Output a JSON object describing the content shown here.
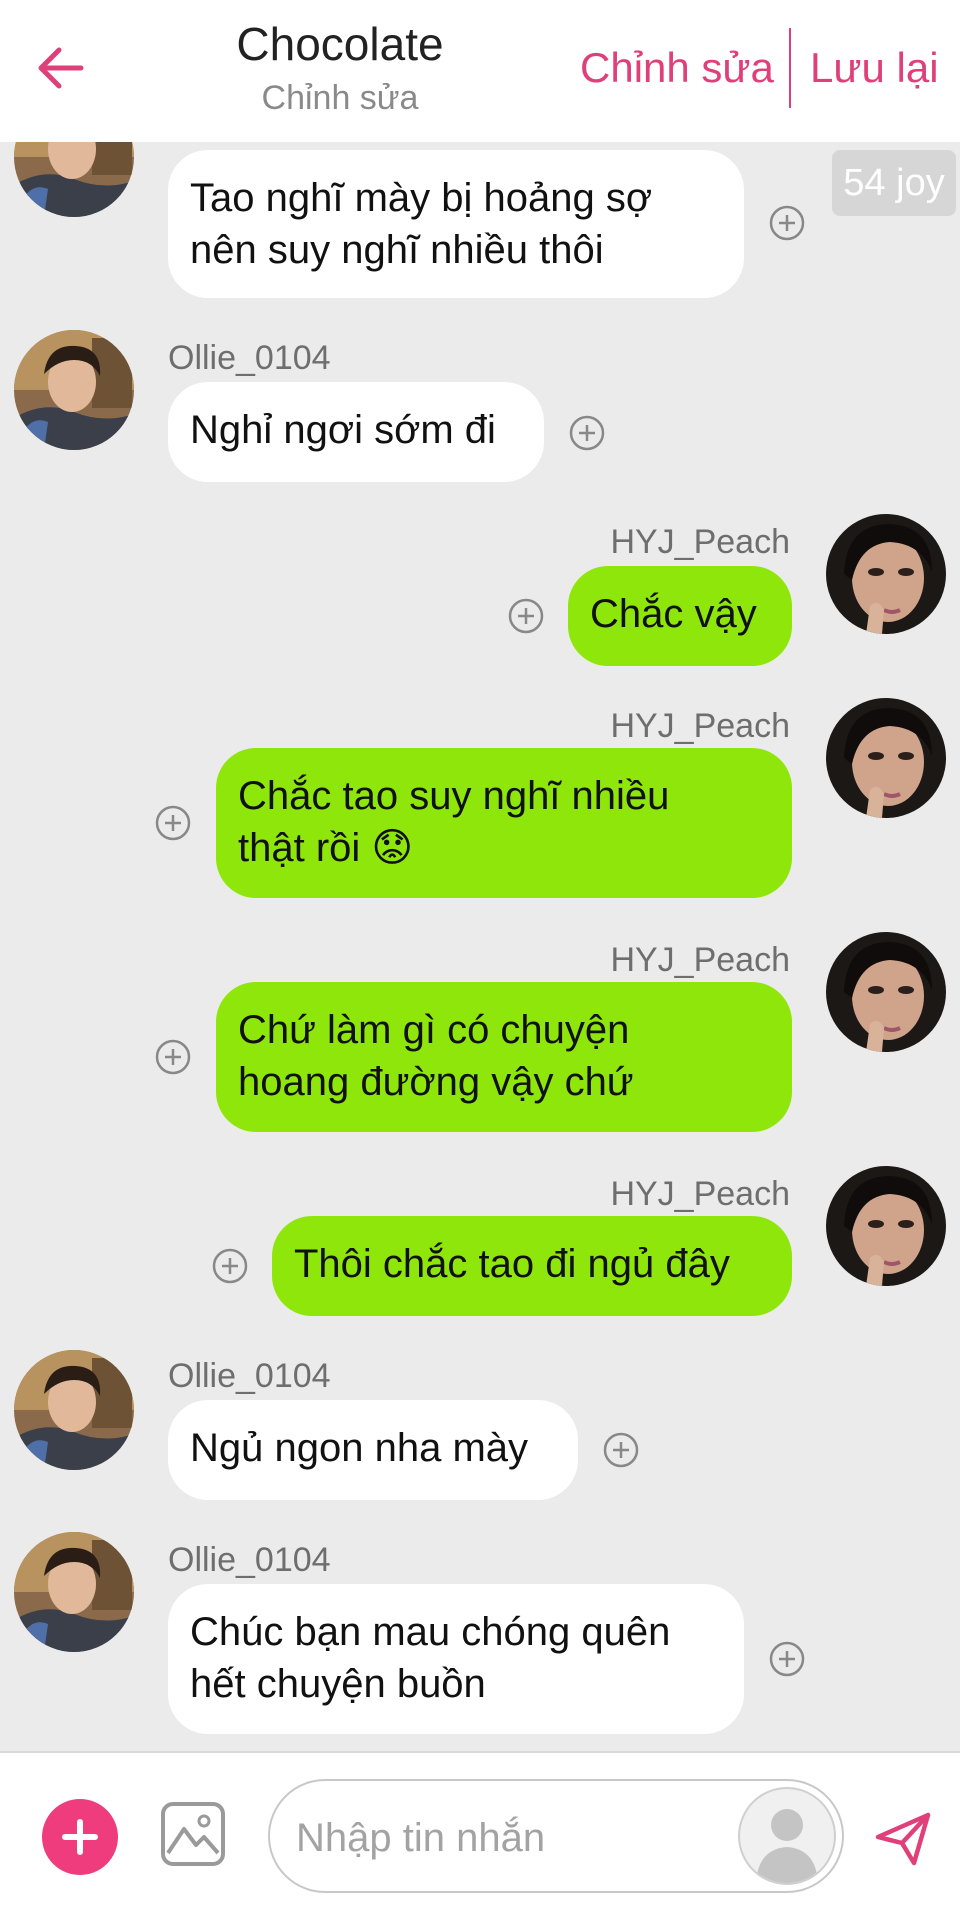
{
  "header": {
    "title": "Chocolate",
    "subtitle": "Chỉnh sửa",
    "edit_label": "Chỉnh sửa",
    "save_label": "Lưu lại",
    "accent_color": "#e0407a"
  },
  "joy_badge": "54 joy",
  "messages": [
    {
      "sender": "Ollie_0104",
      "direction": "incoming",
      "lines": [
        "Tao nghĩ mày bị hoảng sợ",
        "nên suy nghĩ nhiều thôi"
      ],
      "username_visible": false
    },
    {
      "sender": "Ollie_0104",
      "direction": "incoming",
      "lines": [
        "Nghỉ ngơi sớm đi"
      ],
      "username_visible": true
    },
    {
      "sender": "HYJ_Peach",
      "direction": "outgoing",
      "lines": [
        "Chắc vậy"
      ],
      "username_visible": true
    },
    {
      "sender": "HYJ_Peach",
      "direction": "outgoing",
      "lines": [
        "Chắc tao suy nghĩ nhiều",
        "thật rồi 😟"
      ],
      "username_visible": true
    },
    {
      "sender": "HYJ_Peach",
      "direction": "outgoing",
      "lines": [
        "Chứ làm gì có chuyện",
        "hoang đường vậy chứ"
      ],
      "username_visible": true
    },
    {
      "sender": "HYJ_Peach",
      "direction": "outgoing",
      "lines": [
        "Thôi chắc tao đi ngủ đây"
      ],
      "username_visible": true
    },
    {
      "sender": "Ollie_0104",
      "direction": "incoming",
      "lines": [
        "Ngủ ngon nha mày"
      ],
      "username_visible": true
    },
    {
      "sender": "Ollie_0104",
      "direction": "incoming",
      "lines": [
        "Chúc bạn mau chóng quên",
        "hết chuyện buồn"
      ],
      "username_visible": true
    }
  ],
  "composer": {
    "placeholder": "Nhập tin nhắn",
    "add_icon": "plus-icon",
    "image_icon": "image-icon",
    "send_icon": "send-icon"
  },
  "colors": {
    "outgoing_bubble": "#8ee60a",
    "incoming_bubble": "#ffffff",
    "background": "#ebebeb",
    "add_button": "#ee3c7d"
  }
}
